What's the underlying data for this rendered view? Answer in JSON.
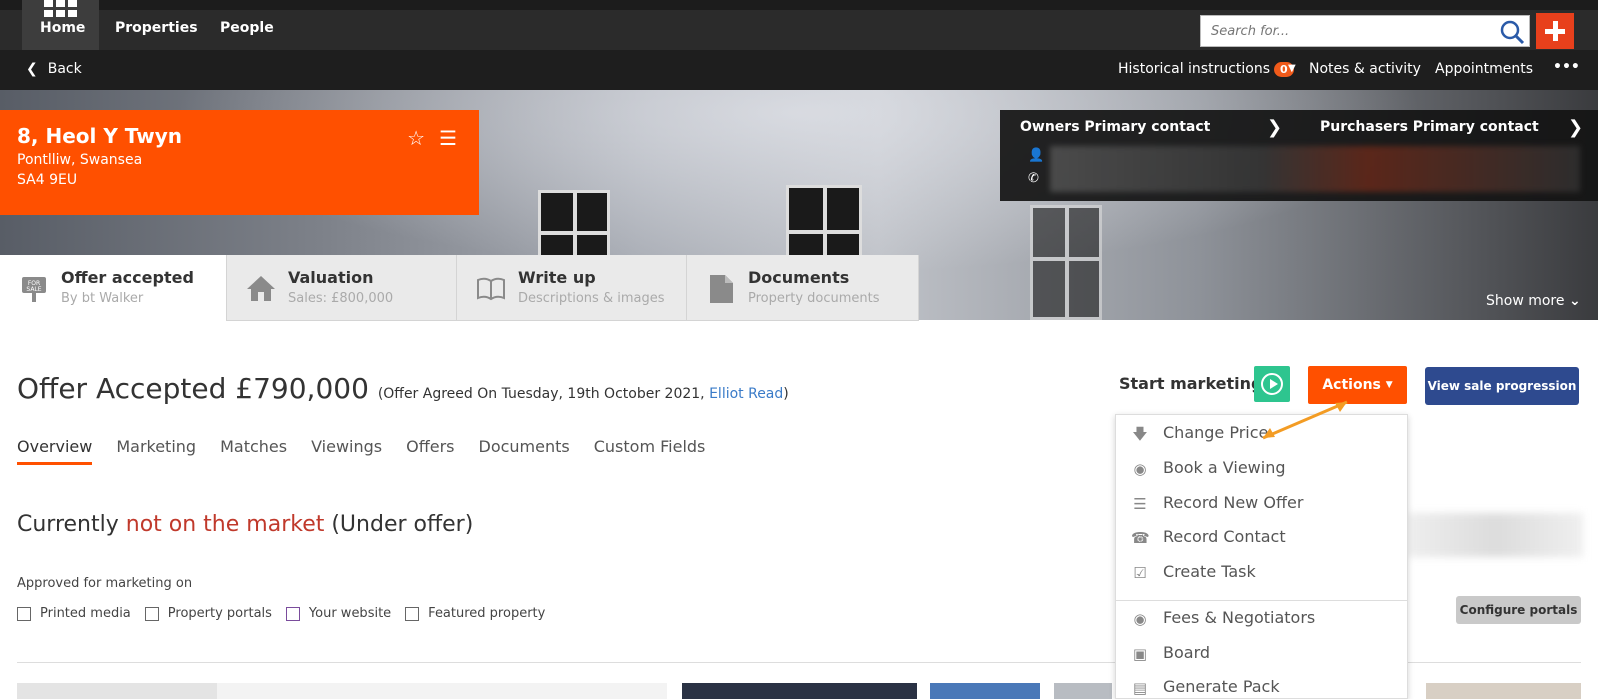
{
  "topbar": {
    "nav": [
      {
        "label": "Home"
      },
      {
        "label": "Properties"
      },
      {
        "label": "People"
      }
    ],
    "search_placeholder": "Search for..."
  },
  "subbar": {
    "back": "Back",
    "historical": "Historical instructions",
    "historical_count": "0",
    "notes": "Notes & activity",
    "appointments": "Appointments",
    "more": "•••"
  },
  "property": {
    "address_line1": "8, Heol Y Twyn",
    "address_line2": "Pontlliw, Swansea",
    "postcode": "SA4 9EU"
  },
  "contacts": {
    "owners": "Owners Primary contact",
    "purchasers": "Purchasers Primary contact"
  },
  "tabs": [
    {
      "title": "Offer accepted",
      "sub": "By bt Walker",
      "icon": "for-sale-sign-icon"
    },
    {
      "title": "Valuation",
      "sub": "Sales: £800,000",
      "icon": "house-icon"
    },
    {
      "title": "Write up",
      "sub": "Descriptions & images",
      "icon": "book-icon"
    },
    {
      "title": "Documents",
      "sub": "Property documents",
      "icon": "document-icon"
    }
  ],
  "show_more": "Show more",
  "status": {
    "title": "Offer Accepted £790,000",
    "detail_prefix": "(Offer Agreed On Tuesday, 19th October 2021, ",
    "agent": "Elliot Read",
    "detail_suffix": ")"
  },
  "start_marketing": "Start marketing",
  "actions_label": "Actions",
  "view_sale_progression": "View sale progression",
  "subnav": [
    "Overview",
    "Marketing",
    "Matches",
    "Viewings",
    "Offers",
    "Documents",
    "Custom Fields"
  ],
  "market": {
    "prefix": "Currently ",
    "highlight": "not on the market",
    "suffix": " (Under offer)"
  },
  "approved_label": "Approved for marketing on",
  "checkboxes": [
    "Printed media",
    "Property portals",
    "Your website",
    "Featured property"
  ],
  "configure_portals": "Configure portals",
  "dropdown": [
    {
      "label": "Change Price",
      "icon": "arrow-down-icon"
    },
    {
      "label": "Book a Viewing",
      "icon": "eye-icon"
    },
    {
      "label": "Record New Offer",
      "icon": "offer-icon"
    },
    {
      "label": "Record Contact",
      "icon": "phone-icon"
    },
    {
      "label": "Create Task",
      "icon": "checkbox-icon"
    },
    {
      "label": "Fees & Negotiators",
      "icon": "piggy-bank-icon"
    },
    {
      "label": "Board",
      "icon": "board-icon"
    },
    {
      "label": "Generate Pack",
      "icon": "doc-icon"
    }
  ],
  "colors": {
    "brand_orange": "#ff5000",
    "nav_dark": "#2b2b2b",
    "primary_blue": "#2e4a8f",
    "play_green": "#2ec58f",
    "link_blue": "#3a7bc8",
    "alert_red": "#c0392b"
  }
}
